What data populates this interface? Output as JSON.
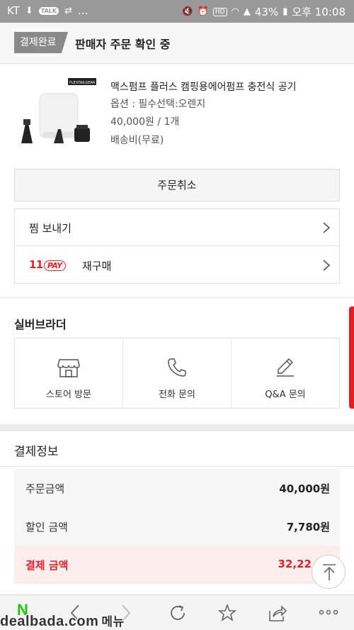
{
  "status_bar": {
    "carrier": "KT",
    "dots": "...",
    "battery": "43%",
    "time": "오후 10:08",
    "hd": "HD",
    "talk": "TALK"
  },
  "header": {
    "badge": "결제완료",
    "title": "판매자 주문 확인 중"
  },
  "product": {
    "name": "맥스펌프 플러스 캠핑용에어펌프 충전식 공기",
    "option": "옵션 : 필수선택:오렌지",
    "price": "40,000원 / 1개",
    "shipping": "배송비(무료)",
    "image_logo": "FLEXTAILGEAR"
  },
  "actions": {
    "cancel": "주문취소",
    "wishlist": "찜 보내기",
    "pay_logo_num": "11",
    "pay_logo_pay": "PAY",
    "rebuy": "재구매"
  },
  "store": {
    "name": "실버브라더",
    "buttons": [
      {
        "label": "스토어 방문",
        "icon": "store-icon"
      },
      {
        "label": "전화 문의",
        "icon": "phone-icon"
      },
      {
        "label": "Q&A 문의",
        "icon": "pencil-icon"
      }
    ]
  },
  "payment": {
    "title": "결제정보",
    "rows": [
      {
        "label": "주문금액",
        "value": "40,000원"
      },
      {
        "label": "할인 금액",
        "value": "7,780원"
      },
      {
        "label": "결제 금액",
        "value": "32,22"
      }
    ]
  },
  "bottom_bar": {
    "logo": "N",
    "watermark": "dealbada.com",
    "menu": "메뉴"
  },
  "colors": {
    "accent_red": "#e8202a",
    "naver_green": "#1ec800",
    "badge_gray": "#8a8a8a"
  }
}
